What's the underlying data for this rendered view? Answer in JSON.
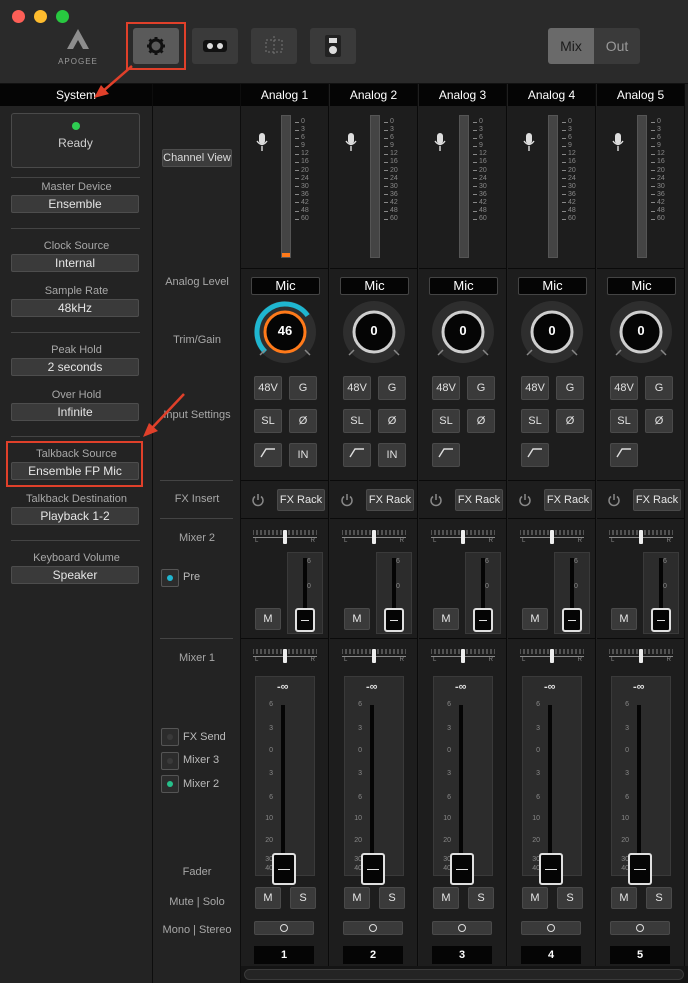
{
  "toolbar": {
    "logo_text": "APOGEE",
    "settings_icon": "gear-icon",
    "mix_label": "Mix",
    "out_label": "Out"
  },
  "system": {
    "header": "System",
    "ready": "Ready",
    "master_device_label": "Master Device",
    "master_device_value": "Ensemble",
    "clock_source_label": "Clock Source",
    "clock_source_value": "Internal",
    "sample_rate_label": "Sample Rate",
    "sample_rate_value": "48kHz",
    "peak_hold_label": "Peak Hold",
    "peak_hold_value": "2 seconds",
    "over_hold_label": "Over Hold",
    "over_hold_value": "Infinite",
    "talkback_source_label": "Talkback Source",
    "talkback_source_value": "Ensemble FP Mic",
    "talkback_dest_label": "Talkback Destination",
    "talkback_dest_value": "Playback 1-2",
    "keyboard_volume_label": "Keyboard Volume",
    "keyboard_volume_value": "Speaker"
  },
  "labels": {
    "channel_view": "Channel View",
    "analog_level": "Analog Level",
    "trim_gain": "Trim/Gain",
    "input_settings": "Input Settings",
    "fx_insert": "FX Insert",
    "mixer2": "Mixer 2",
    "pre": "Pre",
    "mixer1": "Mixer 1",
    "fx_send": "FX Send",
    "mixer3": "Mixer 3",
    "mixer2_send": "Mixer 2",
    "fader": "Fader",
    "mute_solo": "Mute | Solo",
    "mono_stereo": "Mono | Stereo"
  },
  "meter_scale": [
    "0",
    "3",
    "6",
    "9",
    "12",
    "16",
    "20",
    "24",
    "30",
    "36",
    "42",
    "48",
    "60"
  ],
  "fader_scale": [
    "6",
    "3",
    "0",
    "3",
    "6",
    "10",
    "20",
    "30",
    "40",
    "∞"
  ],
  "mixer2_scale": [
    "6",
    "0"
  ],
  "channels": [
    {
      "name": "Analog 1",
      "level": "Mic",
      "gain": "46",
      "gain_fraction": 0.7,
      "meter_fraction": 0.02,
      "num": "1",
      "fader_value": "-∞",
      "b48": "48V",
      "g": "G",
      "sl": "SL",
      "phase": "Ø",
      "in": "IN",
      "m": "M",
      "s": "S",
      "fx": "FX Rack"
    },
    {
      "name": "Analog 2",
      "level": "Mic",
      "gain": "0",
      "gain_fraction": 0,
      "meter_fraction": 0,
      "num": "2",
      "fader_value": "-∞",
      "b48": "48V",
      "g": "G",
      "sl": "SL",
      "phase": "Ø",
      "in": "IN",
      "m": "M",
      "s": "S",
      "fx": "FX Rack"
    },
    {
      "name": "Analog 3",
      "level": "Mic",
      "gain": "0",
      "gain_fraction": 0,
      "meter_fraction": 0,
      "num": "3",
      "fader_value": "-∞",
      "b48": "48V",
      "g": "G",
      "sl": "SL",
      "phase": "Ø",
      "in": "",
      "m": "M",
      "s": "S",
      "fx": "FX Rack"
    },
    {
      "name": "Analog 4",
      "level": "Mic",
      "gain": "0",
      "gain_fraction": 0,
      "meter_fraction": 0,
      "num": "4",
      "fader_value": "-∞",
      "b48": "48V",
      "g": "G",
      "sl": "SL",
      "phase": "Ø",
      "in": "",
      "m": "M",
      "s": "S",
      "fx": "FX Rack"
    },
    {
      "name": "Analog 5",
      "level": "Mic",
      "gain": "0",
      "gain_fraction": 0,
      "meter_fraction": 0,
      "num": "5",
      "fader_value": "-∞",
      "b48": "48V",
      "g": "G",
      "sl": "SL",
      "phase": "Ø",
      "in": "",
      "m": "M",
      "s": "S",
      "fx": "FX Rack"
    }
  ],
  "colors": {
    "accent": "#ff7a1a",
    "teal": "#1fb6d0",
    "green": "#26c08a",
    "highlight": "#e0402a"
  }
}
